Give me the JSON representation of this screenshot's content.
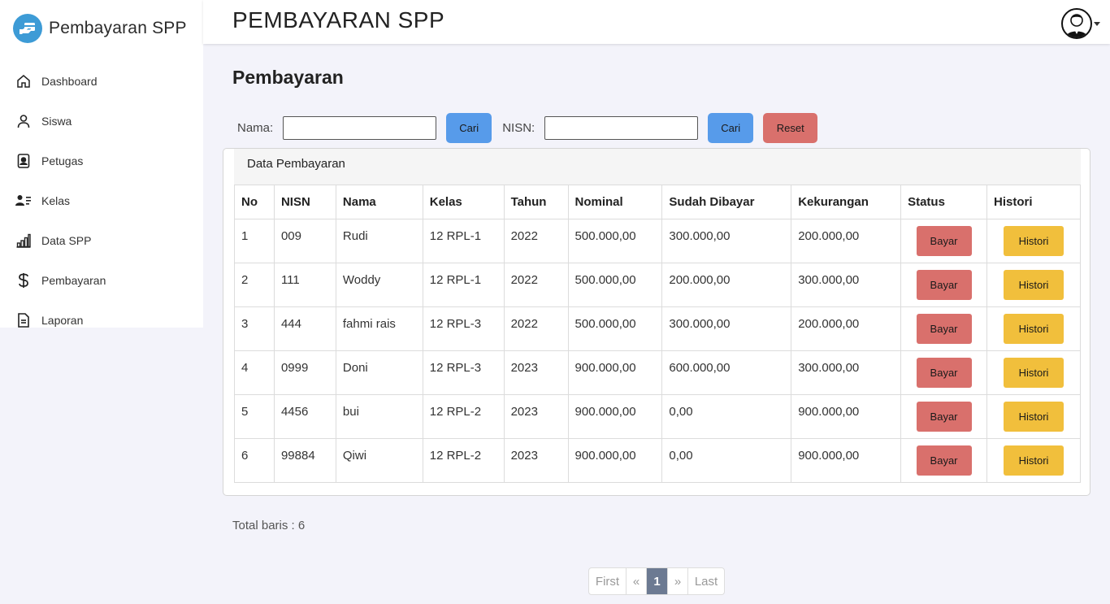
{
  "app": {
    "brand": "Pembayaran SPP",
    "header_title": "PEMBAYARAN SPP"
  },
  "sidebar": {
    "items": [
      {
        "label": "Dashboard",
        "icon": "home-icon"
      },
      {
        "label": "Siswa",
        "icon": "person-icon"
      },
      {
        "label": "Petugas",
        "icon": "badge-icon"
      },
      {
        "label": "Kelas",
        "icon": "person-lines-icon"
      },
      {
        "label": "Data SPP",
        "icon": "bar-chart-icon"
      },
      {
        "label": "Pembayaran",
        "icon": "dollar-icon"
      },
      {
        "label": "Laporan",
        "icon": "document-icon"
      }
    ]
  },
  "main": {
    "section_title": "Pembayaran",
    "search": {
      "nama_label": "Nama:",
      "nama_value": "",
      "cari_label": "Cari",
      "nisn_label": "NISN:",
      "nisn_value": "",
      "cari2_label": "Cari",
      "reset_label": "Reset"
    },
    "card_title": "Data Pembayaran",
    "table": {
      "headers": [
        "No",
        "NISN",
        "Nama",
        "Kelas",
        "Tahun",
        "Nominal",
        "Sudah Dibayar",
        "Kekurangan",
        "Status",
        "Histori"
      ],
      "rows": [
        {
          "no": "1",
          "nisn": "009",
          "nama": "Rudi",
          "kelas": "12 RPL-1",
          "tahun": "2022",
          "nominal": "500.000,00",
          "dibayar": "300.000,00",
          "kekurangan": "200.000,00",
          "bayar": "Bayar",
          "histori": "Histori"
        },
        {
          "no": "2",
          "nisn": "111",
          "nama": "Woddy",
          "kelas": "12 RPL-1",
          "tahun": "2022",
          "nominal": "500.000,00",
          "dibayar": "200.000,00",
          "kekurangan": "300.000,00",
          "bayar": "Bayar",
          "histori": "Histori"
        },
        {
          "no": "3",
          "nisn": "444",
          "nama": "fahmi rais",
          "kelas": "12 RPL-3",
          "tahun": "2022",
          "nominal": "500.000,00",
          "dibayar": "300.000,00",
          "kekurangan": "200.000,00",
          "bayar": "Bayar",
          "histori": "Histori"
        },
        {
          "no": "4",
          "nisn": "0999",
          "nama": "Doni",
          "kelas": "12 RPL-3",
          "tahun": "2023",
          "nominal": "900.000,00",
          "dibayar": "600.000,00",
          "kekurangan": "300.000,00",
          "bayar": "Bayar",
          "histori": "Histori"
        },
        {
          "no": "5",
          "nisn": "4456",
          "nama": "bui",
          "kelas": "12 RPL-2",
          "tahun": "2023",
          "nominal": "900.000,00",
          "dibayar": "0,00",
          "kekurangan": "900.000,00",
          "bayar": "Bayar",
          "histori": "Histori"
        },
        {
          "no": "6",
          "nisn": "99884",
          "nama": "Qiwi",
          "kelas": "12 RPL-2",
          "tahun": "2023",
          "nominal": "900.000,00",
          "dibayar": "0,00",
          "kekurangan": "900.000,00",
          "bayar": "Bayar",
          "histori": "Histori"
        }
      ]
    },
    "total_text": "Total baris : 6",
    "pagination": {
      "first": "First",
      "prev": "«",
      "current": "1",
      "next": "»",
      "last": "Last"
    }
  },
  "colors": {
    "brand_logo": "#3d9bd6",
    "blue_button": "#579bea",
    "red_button": "#d9706c",
    "yellow_button": "#f1bf3c",
    "active_page": "#6c7a92"
  }
}
